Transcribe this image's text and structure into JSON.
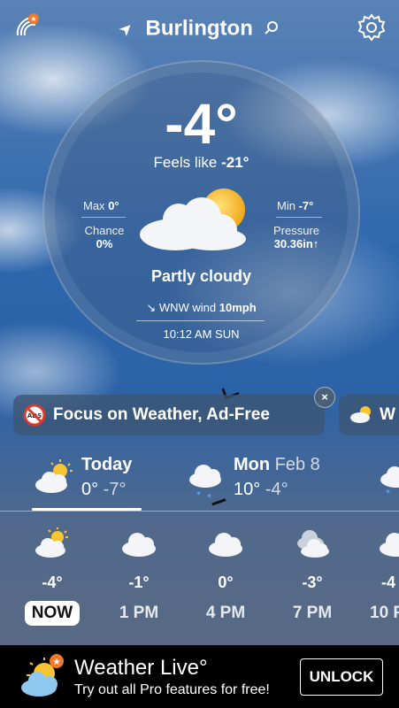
{
  "header": {
    "city": "Burlington",
    "icons": [
      "location-arrow-icon",
      "search-icon",
      "gear-icon",
      "radar-logo-icon"
    ]
  },
  "current": {
    "temperature": "-4°",
    "feels_like_label": "Feels like",
    "feels_like_value": "-21°",
    "max_label": "Max",
    "max_value": "0°",
    "min_label": "Min",
    "min_value": "-7°",
    "chance_label": "Chance",
    "chance_value": "0%",
    "pressure_label": "Pressure",
    "pressure_value": "30.36in↑",
    "condition": "Partly cloudy",
    "wind_prefix": "WNW wind",
    "wind_speed": "10mph",
    "time": "10:12 AM SUN"
  },
  "promo": {
    "text": "Focus on Weather, Ad-Free",
    "close_label": "×",
    "next_text": "W"
  },
  "daily": [
    {
      "name": "Today",
      "date": "",
      "high": "0°",
      "low": "-7°",
      "icon": "partly-cloudy-icon"
    },
    {
      "name": "Mon",
      "date": "Feb 8",
      "high": "10°",
      "low": "-4°",
      "icon": "snow-cloud-icon"
    }
  ],
  "hourly": [
    {
      "temp": "-4°",
      "time": "NOW",
      "icon": "partly-cloudy-icon"
    },
    {
      "temp": "-1°",
      "time": "1 PM",
      "icon": "cloud-icon"
    },
    {
      "temp": "0°",
      "time": "4 PM",
      "icon": "cloud-icon"
    },
    {
      "temp": "-3°",
      "time": "7 PM",
      "icon": "clouds-icon"
    },
    {
      "temp": "-4",
      "time": "10 P",
      "icon": "cloud-icon"
    }
  ],
  "banner": {
    "title": "Weather Live°",
    "subtitle": "Try out all Pro features for free!",
    "unlock_label": "UNLOCK"
  },
  "colors": {
    "accent_orange": "#f07a2a",
    "sun_yellow": "#f7c531",
    "banner_bg": "#000000"
  }
}
